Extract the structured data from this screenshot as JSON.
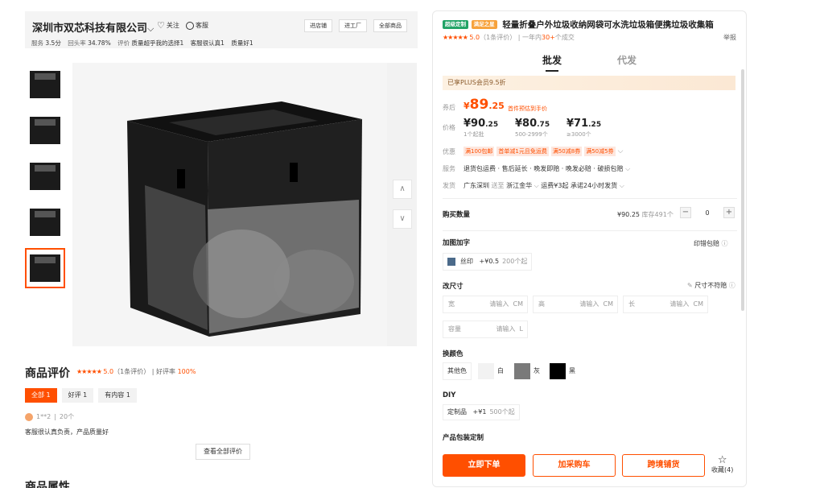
{
  "shop": {
    "name": "深圳市双芯科技有限公司",
    "follow_label": "关注",
    "service_label": "客服",
    "buttons": [
      "进店铺",
      "进工厂",
      "全部商品"
    ],
    "stats": {
      "service_label": "服务",
      "service_value": "3.5分",
      "repurchase_label": "回头率",
      "repurchase_value": "34.78%",
      "review_label": "评价",
      "review_tags": [
        "质量超乎我的选择1",
        "客服很认真1",
        "质量好1"
      ]
    }
  },
  "gallery": {
    "thumb_count": 5,
    "active_thumb": 4,
    "nav_up": "∧",
    "nav_down": "∨"
  },
  "reviews": {
    "title": "商品评价",
    "stars": "★★★★★",
    "score": "5.0",
    "count_text": "（1条评价）",
    "sep": "|",
    "good_rate_label": "好评率",
    "good_rate_value": "100%",
    "tabs": [
      "全部 1",
      "好评 1",
      "有内容 1"
    ],
    "item": {
      "user": "1**2",
      "sep": "|",
      "quantity": "20个",
      "text": "客服很认真负责，产品质量好"
    },
    "view_all": "查看全部评价",
    "attributes_title": "商品属性"
  },
  "product": {
    "tag_green": "超级定制",
    "tag_orange": "满足之星",
    "title": "轻量折叠户外垃圾收纳网袋可水洗垃圾箱便携垃圾收集箱",
    "stars": "★★★★★",
    "score": "5.0",
    "review_count": "（1条评价）",
    "sep": "|",
    "sales_prefix": "一年内",
    "sales_value": "30+",
    "sales_suffix": "个成交",
    "report": "举报",
    "tabs": [
      "批发",
      "代发"
    ],
    "plus_text": "已享PLUS会员9.5折",
    "after_label": "券后",
    "after_currency": "¥",
    "after_price": "89",
    "after_decimal": ".25",
    "after_note": "首件预估到手价",
    "price_label": "价格",
    "tiers": [
      {
        "int": "¥90",
        "dec": ".25",
        "qty": "1个起批"
      },
      {
        "int": "¥80",
        "dec": ".75",
        "qty": "500-2999个"
      },
      {
        "int": "¥71",
        "dec": ".25",
        "qty": "≥3000个"
      }
    ],
    "promo_label": "优惠",
    "promos": [
      "满100包邮",
      "首单减1元且免运费",
      "满50减8券",
      "满50减5券"
    ],
    "service_label": "服务",
    "services": "退货包运费 · 售后延长 · 晚发即赔 · 晚发必赔 · 破损包赔",
    "ship_label": "发货",
    "ship_from": "广东深圳",
    "ship_to_label": "送至",
    "ship_to": "浙江金华",
    "ship_fee": "运费¥3起",
    "ship_promise": "承诺24小时发货",
    "qty_title": "购买数量",
    "qty_price": "¥90.25",
    "qty_stock": "库存491个",
    "qty_minus": "−",
    "qty_value": "0",
    "qty_plus": "+",
    "logo_title": "加图加字",
    "logo_link": "印错包赔",
    "logo_option": {
      "name": "丝印",
      "price": "+¥0.5",
      "moq": "200个起"
    },
    "size_title": "改尺寸",
    "size_link": "尺寸不符赔",
    "size_fields": [
      {
        "label": "宽",
        "placeholder": "请输入",
        "unit": "CM"
      },
      {
        "label": "高",
        "placeholder": "请输入",
        "unit": "CM"
      },
      {
        "label": "长",
        "placeholder": "请输入",
        "unit": "CM"
      },
      {
        "label": "容量",
        "placeholder": "请输入",
        "unit": "L"
      }
    ],
    "color_title": "换颜色",
    "colors": [
      {
        "name": "其他色",
        "hex": ""
      },
      {
        "name": "白",
        "hex": "#f2f2f2"
      },
      {
        "name": "灰",
        "hex": "#7a7a7a"
      },
      {
        "name": "黑",
        "hex": "#000000"
      }
    ],
    "diy_title": "DIY",
    "diy_option": {
      "name": "定制品",
      "price": "+¥1",
      "moq": "500个起"
    },
    "pack_title": "产品包装定制",
    "actions": {
      "buy": "立即下单",
      "cart": "加采购车",
      "cross": "跨境铺货",
      "fav": "收藏",
      "fav_count": "(4)"
    }
  },
  "colors": {
    "accent": "#ff4f00",
    "green_tag": "#21a366",
    "orange_tag": "#f7a23b",
    "plus_text": "#8a5a2b"
  }
}
